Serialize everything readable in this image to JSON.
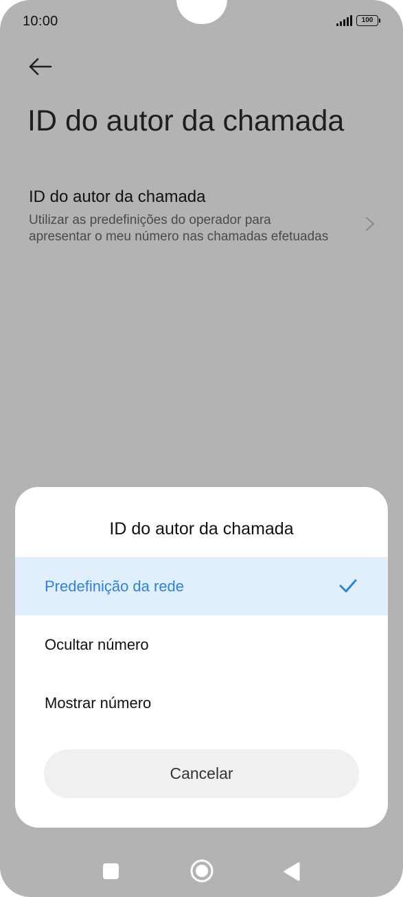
{
  "status_bar": {
    "time": "10:00",
    "battery": "100"
  },
  "header": {
    "title": "ID do autor da chamada"
  },
  "settings": [
    {
      "title": "ID do autor da chamada",
      "description": "Utilizar as predefinições do operador para apresentar o meu número nas chamadas efetuadas"
    }
  ],
  "dialog": {
    "title": "ID do autor da chamada",
    "options": [
      {
        "label": "Predefinição da rede",
        "selected": true
      },
      {
        "label": "Ocultar número",
        "selected": false
      },
      {
        "label": "Mostrar número",
        "selected": false
      }
    ],
    "cancel_label": "Cancelar"
  },
  "colors": {
    "accent": "#2a83e2",
    "selected_background": "#e1eefb",
    "scrim": "#b3b3b3"
  },
  "icons": {
    "back": "arrow-left-icon",
    "chevron": "chevron-right-icon",
    "check": "check-icon",
    "nav_recents": "square-icon",
    "nav_home": "circle-icon",
    "nav_back": "triangle-left-icon"
  }
}
